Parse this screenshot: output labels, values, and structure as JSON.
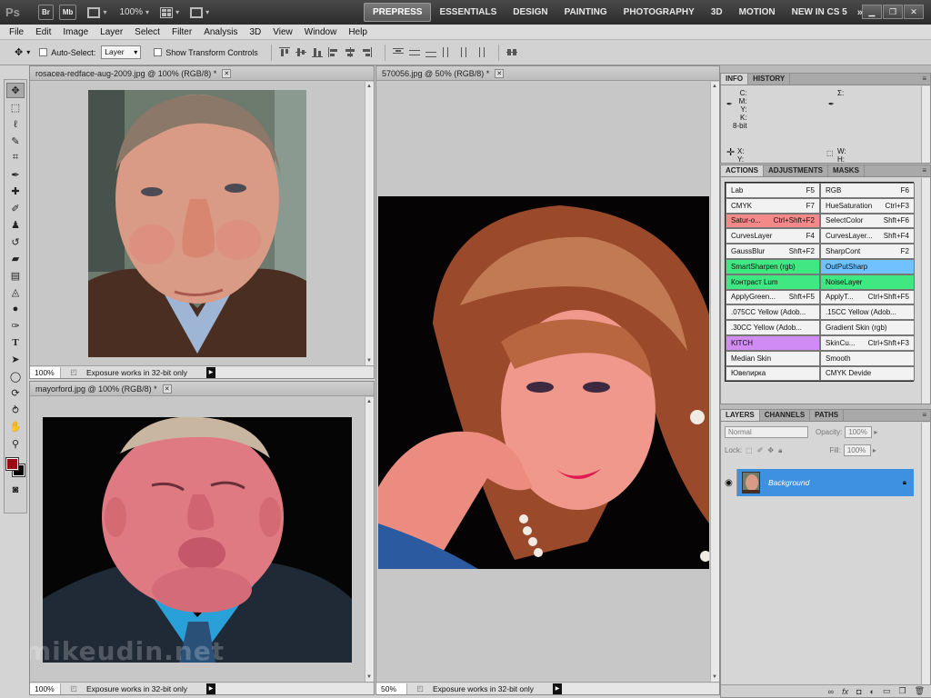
{
  "appbar": {
    "logo": "Ps",
    "buttons": [
      "Br",
      "Mb"
    ],
    "zoom": "100%",
    "workspaces": [
      "PREPRESS",
      "ESSENTIALS",
      "DESIGN",
      "PAINTING",
      "PHOTOGRAPHY",
      "3D",
      "MOTION",
      "NEW IN CS 5"
    ],
    "active_workspace": "PREPRESS",
    "more": "»"
  },
  "menu": [
    "File",
    "Edit",
    "Image",
    "Layer",
    "Select",
    "Filter",
    "Analysis",
    "3D",
    "View",
    "Window",
    "Help"
  ],
  "options": {
    "auto_select_label": "Auto-Select:",
    "auto_select_value": "Layer",
    "transform_label": "Show Transform Controls"
  },
  "documents": [
    {
      "title": "rosacea-redface-aug-2009.jpg @ 100% (RGB/8) *",
      "zoom": "100%",
      "status": "Exposure works in 32-bit only"
    },
    {
      "title": "mayorford.jpg @ 100% (RGB/8) *",
      "zoom": "100%",
      "status": "Exposure works in 32-bit only"
    },
    {
      "title": "570056.jpg @ 50% (RGB/8) *",
      "zoom": "50%",
      "status": "Exposure works in 32-bit only"
    }
  ],
  "info_panel": {
    "tabs": [
      "INFO",
      "HISTORY"
    ],
    "cmyk": "C:\nM:\nY:\nK:\n8-bit",
    "sigma": "Σ:",
    "xy": "X:\nY:",
    "wh": "W:\nH:"
  },
  "actions_panel": {
    "tabs": [
      "ACTIONS",
      "ADJUSTMENTS",
      "MASKS"
    ],
    "colors": {
      "red": "#f38989",
      "green": "#3fe880",
      "blue": "#6fc2ff",
      "violet": "#d08cf2",
      "plain": "#f2f2f2"
    },
    "items": [
      {
        "name": "Lab",
        "key": "F5",
        "color": "plain"
      },
      {
        "name": "RGB",
        "key": "F6",
        "color": "plain"
      },
      {
        "name": "CMYK",
        "key": "F7",
        "color": "plain"
      },
      {
        "name": "HueSaturation",
        "key": "Ctrl+F3",
        "color": "plain"
      },
      {
        "name": "Satur-o...",
        "key": "Ctrl+Shft+F2",
        "color": "red"
      },
      {
        "name": "SelectColor",
        "key": "Shft+F6",
        "color": "plain"
      },
      {
        "name": "CurvesLayer",
        "key": "F4",
        "color": "plain"
      },
      {
        "name": "CurvesLayer...",
        "key": "Shft+F4",
        "color": "plain"
      },
      {
        "name": "GaussBlur",
        "key": "Shft+F2",
        "color": "plain"
      },
      {
        "name": "SharpCont",
        "key": "F2",
        "color": "plain"
      },
      {
        "name": "SmartSharpen (rgb)",
        "key": "",
        "color": "green"
      },
      {
        "name": "OutPutSharp",
        "key": "",
        "color": "blue"
      },
      {
        "name": "Контраст Lum",
        "key": "",
        "color": "green"
      },
      {
        "name": "NoiseLayer",
        "key": "",
        "color": "green"
      },
      {
        "name": "ApplyGreen...",
        "key": "Shft+F5",
        "color": "plain"
      },
      {
        "name": "ApplyT...",
        "key": "Ctrl+Shft+F5",
        "color": "plain"
      },
      {
        "name": ".075CC Yellow (Adob...",
        "key": "",
        "color": "plain"
      },
      {
        "name": ".15CC Yellow (Adob...",
        "key": "",
        "color": "plain"
      },
      {
        "name": ".30CC Yellow (Adob...",
        "key": "",
        "color": "plain"
      },
      {
        "name": "Gradient Skin (rgb)",
        "key": "",
        "color": "plain"
      },
      {
        "name": "KITCH",
        "key": "",
        "color": "violet"
      },
      {
        "name": "SkinCu...",
        "key": "Ctrl+Shft+F3",
        "color": "plain"
      },
      {
        "name": "Median Skin",
        "key": "",
        "color": "plain"
      },
      {
        "name": "Smooth",
        "key": "",
        "color": "plain"
      },
      {
        "name": "Ювелирка",
        "key": "",
        "color": "plain"
      },
      {
        "name": "CMYK Devide",
        "key": "",
        "color": "plain"
      }
    ]
  },
  "layers_panel": {
    "tabs": [
      "LAYERS",
      "CHANNELS",
      "PATHS"
    ],
    "blend_mode": "Normal",
    "opacity_label": "Opacity:",
    "opacity": "100%",
    "lock_label": "Lock:",
    "fill_label": "Fill:",
    "fill": "100%",
    "layer_name": "Background"
  },
  "watermark": "mikeudin.net"
}
